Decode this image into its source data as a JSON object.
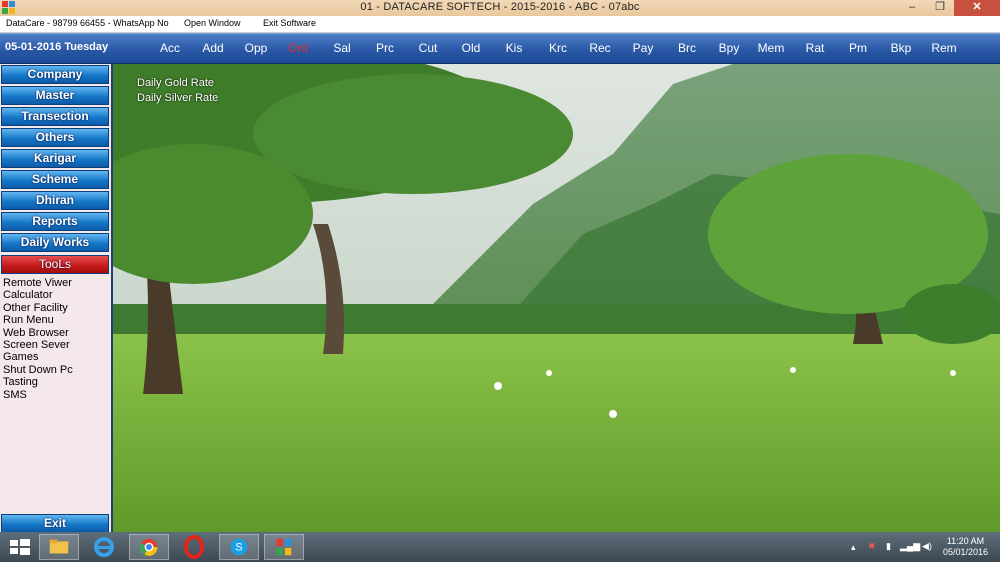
{
  "window": {
    "title": "01  -  DATACARE SOFTECH  -  2015-2016  -  ABC  -  07abc",
    "controls": [
      "–",
      "❐",
      "✕"
    ]
  },
  "menubar": {
    "items": [
      "DataCare - 98799 66455 - WhatsApp No",
      "Open Window",
      "Exit Software"
    ]
  },
  "toolbar": {
    "date": "05-01-2016  Tuesday",
    "items": [
      "Acc",
      "Add",
      "Opp",
      "Ord",
      "Sal",
      "Prc",
      "Cut",
      "Old",
      "Kis",
      "Krc",
      "Rec",
      "Pay",
      "Brc",
      "Bpy",
      "Mem",
      "Rat",
      "Pm",
      "Bkp",
      "Rem"
    ],
    "active": "Ord",
    "active_color": "#e03030"
  },
  "sidebar": {
    "buttons": [
      "Company",
      "Master",
      "Transection",
      "Others",
      "Karigar",
      "Scheme",
      "Dhiran",
      "Reports",
      "Daily Works"
    ],
    "tools_label": "TooLs",
    "tools_items": [
      "Remote Viwer",
      "Calculator",
      "Other Facility",
      "Run Menu",
      "Web Browser",
      "Screen Sever",
      "Games",
      "Shut Down Pc",
      "Tasting",
      "SMS"
    ],
    "exit_label": "Exit"
  },
  "main": {
    "gold_rate_label": "Daily Gold Rate",
    "silver_rate_label": "Daily Silver Rate"
  },
  "taskbar": {
    "apps": [
      "windows-start",
      "file-explorer",
      "internet-explorer",
      "chrome",
      "opera",
      "skype",
      "datacare-app"
    ],
    "time": "11:20 AM",
    "date": "05/01/2016"
  }
}
